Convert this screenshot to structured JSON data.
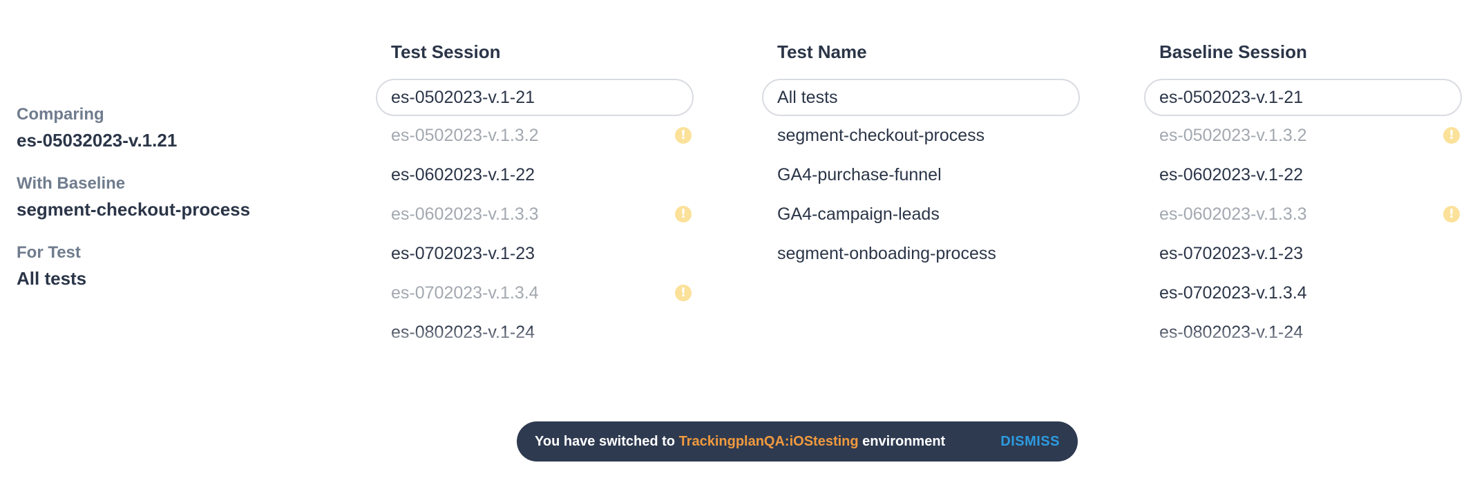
{
  "summary": {
    "comparing_label": "Comparing",
    "comparing_value": "es-05032023-v.1.21",
    "baseline_label": "With Baseline",
    "baseline_value": "segment-checkout-process",
    "test_label": "For Test",
    "test_value": "All tests"
  },
  "test_session": {
    "title": "Test Session",
    "selected": "es-0502023-v.1-21",
    "items": [
      {
        "label": "es-0502023-v.1.3.2",
        "disabled": true,
        "warning": true
      },
      {
        "label": "es-0602023-v.1-22",
        "disabled": false,
        "warning": false
      },
      {
        "label": "es-0602023-v.1.3.3",
        "disabled": true,
        "warning": true
      },
      {
        "label": "es-0702023-v.1-23",
        "disabled": false,
        "warning": false
      },
      {
        "label": "es-0702023-v.1.3.4",
        "disabled": true,
        "warning": true
      },
      {
        "label": "es-0802023-v.1-24",
        "disabled": false,
        "warning": false
      },
      {
        "label": "",
        "disabled": true,
        "warning": true
      }
    ]
  },
  "test_name": {
    "title": "Test Name",
    "selected": "All tests",
    "items": [
      {
        "label": "segment-checkout-process",
        "disabled": false,
        "warning": false
      },
      {
        "label": "GA4-purchase-funnel",
        "disabled": false,
        "warning": false
      },
      {
        "label": "GA4-campaign-leads",
        "disabled": false,
        "warning": false
      },
      {
        "label": "segment-onboading-process",
        "disabled": false,
        "warning": false
      }
    ]
  },
  "baseline_session": {
    "title": "Baseline Session",
    "selected": "es-0502023-v.1-21",
    "items": [
      {
        "label": "es-0502023-v.1.3.2",
        "disabled": true,
        "warning": true
      },
      {
        "label": "es-0602023-v.1-22",
        "disabled": false,
        "warning": false
      },
      {
        "label": "es-0602023-v.1.3.3",
        "disabled": true,
        "warning": true
      },
      {
        "label": "es-0702023-v.1-23",
        "disabled": false,
        "warning": false
      },
      {
        "label": "es-0702023-v.1.3.4",
        "disabled": false,
        "warning": false
      },
      {
        "label": "es-0802023-v.1-24",
        "disabled": false,
        "warning": false
      },
      {
        "label": "",
        "disabled": true,
        "warning": true
      }
    ]
  },
  "toast": {
    "prefix": "You have switched to",
    "environment": "TrackingplanQA:iOStesting",
    "suffix": "environment",
    "dismiss_label": "DISMISS"
  },
  "icons": {
    "warning_icon": "warning-circle-icon",
    "warning_glyph": "!"
  },
  "colors": {
    "text_primary": "#2b3548",
    "text_muted": "#6f7c8e",
    "text_disabled": "#a3a8b0",
    "warning": "#fbe199",
    "toast_bg": "#2e3a50",
    "toast_env": "#f09a3e",
    "toast_dismiss": "#2d9be0"
  }
}
